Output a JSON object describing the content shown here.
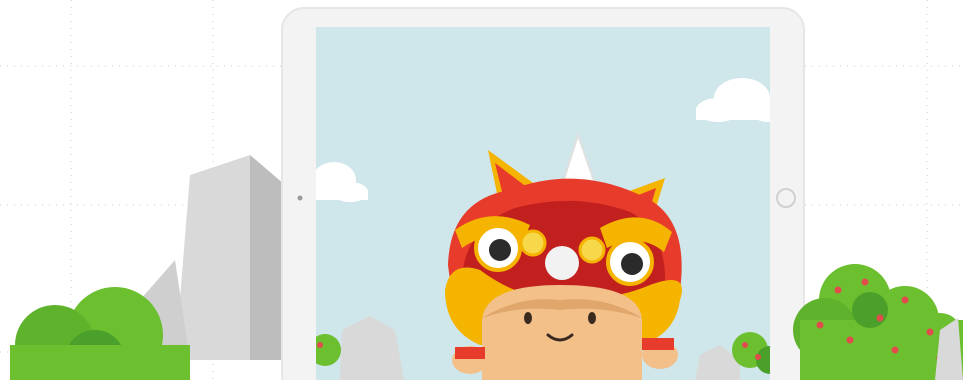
{
  "scene": {
    "background": "#ffffff",
    "grid_color": "#c9ccd0",
    "tablet": {
      "frame_color": "#f3f3f3",
      "screen_color": "#cfe6ea"
    },
    "rock_colors": [
      "#d9d9d9",
      "#bdbdbd",
      "#9a9a9a"
    ],
    "bush_colors": [
      "#6cbf2f",
      "#4aa02a",
      "#e24b4b"
    ],
    "character": {
      "icon": "lion-dance-icon",
      "head_colors": [
        "#f5b400",
        "#e73b2b",
        "#c21f1f"
      ],
      "face_color": "#f3c08a"
    }
  }
}
